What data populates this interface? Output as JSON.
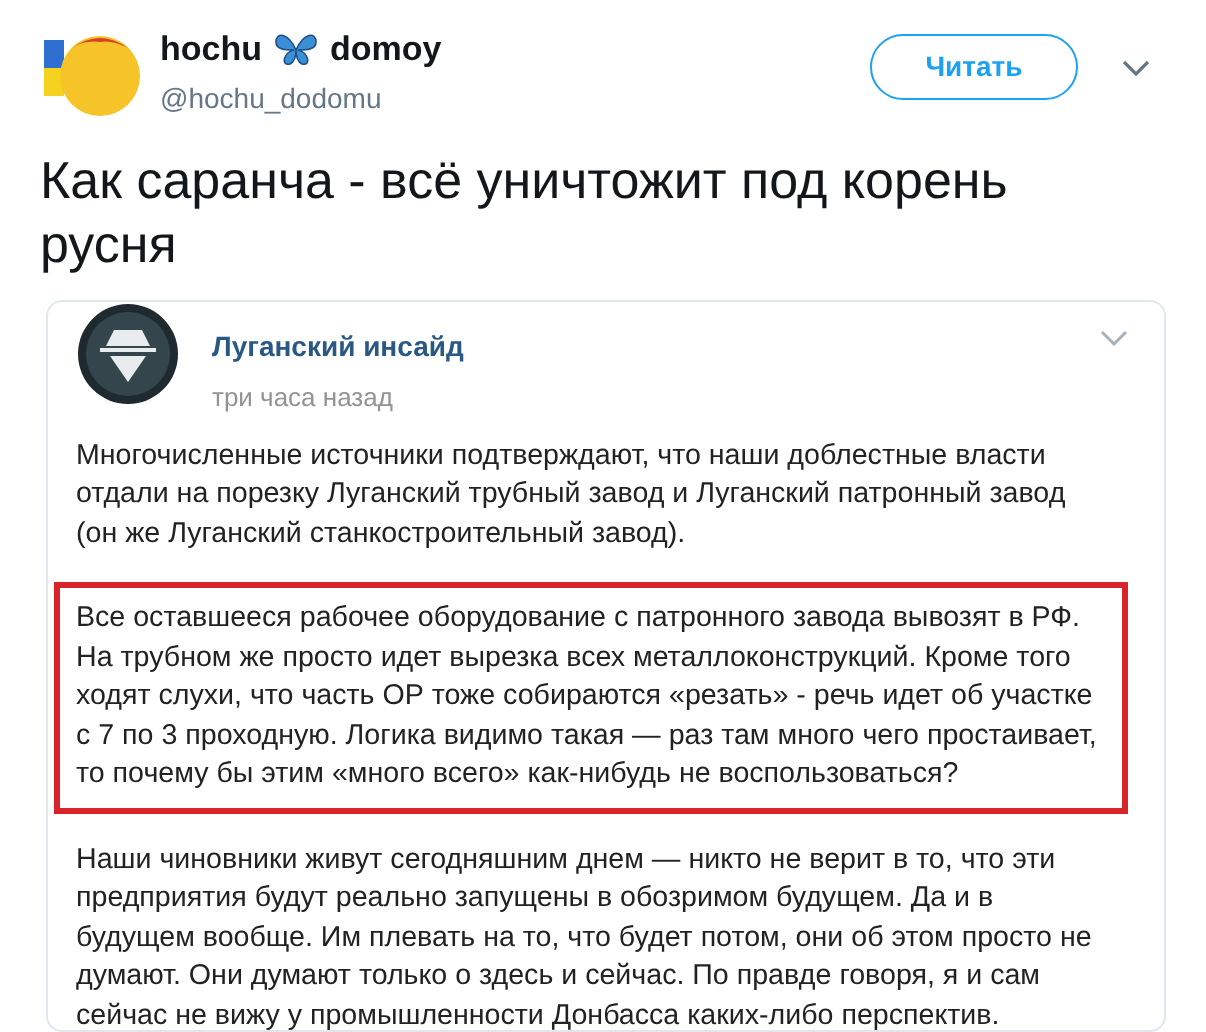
{
  "tweet": {
    "name_first": "hochu",
    "name_second": "domoy",
    "handle": "@hochu_dodomu",
    "follow_button": "Читать",
    "text": "Как саранча - всё уничтожит под корень русня"
  },
  "embedded_post": {
    "channel": "Луганский инсайд",
    "time": "три часа назад",
    "paragraphs": [
      {
        "text": "Многочисленные источники подтверждают, что наши доблестные власти отдали на порезку Луганский трубный завод и Луганский патронный завод (он же Луганский станкостроительный завод).",
        "highlighted": false
      },
      {
        "text": "Все оставшееся рабочее оборудование с патронного завода вывозят в РФ. На трубном же просто идет вырезка всех металлоконструкций. Кроме того ходят слухи, что часть ОР тоже собираются «резать» - речь идет об участке с 7 по 3 проходную. Логика видимо такая — раз там много чего простаивает, то почему бы этим «много всего» как-нибудь не воспользоваться?",
        "highlighted": true
      },
      {
        "text": "Наши чиновники живут сегодняшним днем — никто не верит в то, что эти предприятия будут реально запущены в обозримом будущем. Да и в будущем вообще. Им плевать на то, что будет потом, они об этом просто не думают. Они думают только о здесь и сейчас. По правде говоря, я и сам сейчас не вижу у промышленности Донбасса каких-либо перспектив.",
        "highlighted": false
      }
    ]
  }
}
